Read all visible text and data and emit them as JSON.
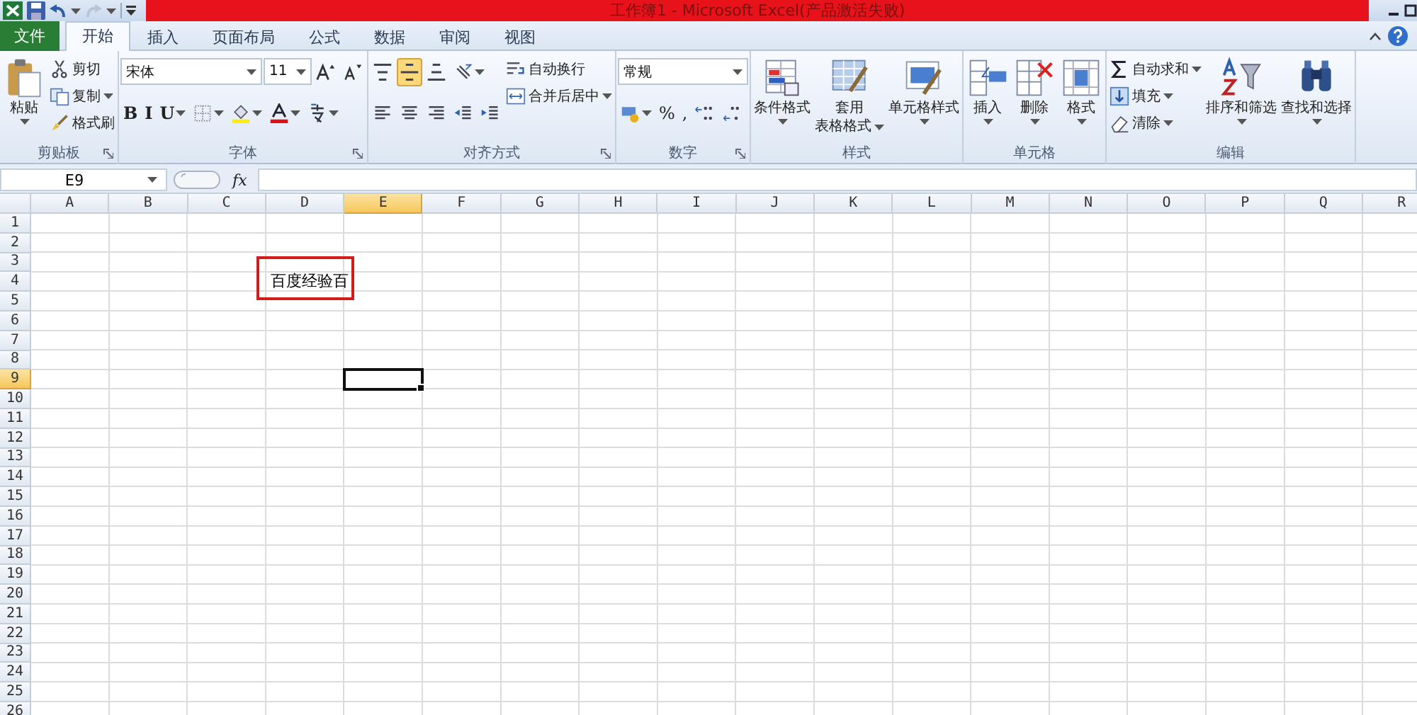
{
  "title_bar": {
    "title": "工作簿1 - Microsoft Excel(产品激活失败)",
    "redo_disabled": true
  },
  "tabs": [
    {
      "label": "文件",
      "kind": "file",
      "selected": false
    },
    {
      "label": "开始",
      "kind": "tab",
      "selected": true
    },
    {
      "label": "插入",
      "kind": "tab",
      "selected": false
    },
    {
      "label": "页面布局",
      "kind": "tab",
      "selected": false
    },
    {
      "label": "公式",
      "kind": "tab",
      "selected": false
    },
    {
      "label": "数据",
      "kind": "tab",
      "selected": false
    },
    {
      "label": "审阅",
      "kind": "tab",
      "selected": false
    },
    {
      "label": "视图",
      "kind": "tab",
      "selected": false
    }
  ],
  "ribbon": {
    "groups": [
      {
        "label": "剪贴板",
        "launcher": true,
        "columns": [
          {
            "kind": "large",
            "label": "粘贴",
            "dropdown": true
          },
          {
            "kind": "stack",
            "items": [
              {
                "kind": "small",
                "label": "剪切",
                "dropdown": false
              },
              {
                "kind": "small",
                "label": "复制",
                "dropdown": true
              },
              {
                "kind": "small",
                "label": "格式刷",
                "dropdown": false
              }
            ]
          }
        ]
      },
      {
        "label": "字体",
        "launcher": true,
        "columns": [
          {
            "kind": "toolbars",
            "toolbars": [
              {
                "items": [
                  {
                    "kind": "combo",
                    "value": "宋体"
                  },
                  {
                    "kind": "combo",
                    "value": "11"
                  },
                  {
                    "kind": "icon",
                    "dropdown": false
                  },
                  {
                    "kind": "icon",
                    "dropdown": false
                  }
                ]
              },
              {
                "items": [
                  {
                    "kind": "text",
                    "label": "B",
                    "selected": false,
                    "dropdown": false
                  },
                  {
                    "kind": "text",
                    "label": "I",
                    "selected": false,
                    "dropdown": false
                  },
                  {
                    "kind": "text",
                    "label": "U",
                    "selected": false,
                    "dropdown": true
                  },
                  {
                    "kind": "icon",
                    "dropdown": true
                  },
                  {
                    "kind": "icon",
                    "dropdown": true
                  },
                  {
                    "kind": "icon",
                    "dropdown": true
                  },
                  {
                    "kind": "icon",
                    "dropdown": true
                  }
                ]
              }
            ]
          }
        ]
      },
      {
        "label": "对齐方式",
        "launcher": true,
        "columns": [
          {
            "kind": "toolbars",
            "toolbars": [
              {
                "items": [
                  {
                    "kind": "icon",
                    "selected": false,
                    "dropdown": false
                  },
                  {
                    "kind": "icon",
                    "selected": true,
                    "dropdown": false
                  },
                  {
                    "kind": "icon",
                    "selected": false,
                    "dropdown": false
                  },
                  {
                    "kind": "icon",
                    "dropdown": true
                  }
                ]
              },
              {
                "items": [
                  {
                    "kind": "icon",
                    "selected": false,
                    "dropdown": false
                  },
                  {
                    "kind": "icon",
                    "selected": false,
                    "dropdown": false
                  },
                  {
                    "kind": "icon",
                    "selected": false,
                    "dropdown": false
                  },
                  {
                    "kind": "icon",
                    "dropdown": false
                  },
                  {
                    "kind": "icon",
                    "dropdown": false
                  }
                ]
              }
            ]
          },
          {
            "kind": "stack",
            "items": [
              {
                "kind": "small",
                "label": "自动换行",
                "dropdown": false
              },
              {
                "kind": "small",
                "label": "合并后居中",
                "dropdown": true
              }
            ]
          }
        ]
      },
      {
        "label": "数字",
        "launcher": true,
        "columns": [
          {
            "kind": "toolbars",
            "toolbars": [
              {
                "items": [
                  {
                    "kind": "combo",
                    "value": "常规"
                  }
                ]
              },
              {
                "items": [
                  {
                    "kind": "icon",
                    "dropdown": true
                  },
                  {
                    "kind": "text",
                    "label": "%",
                    "dropdown": false
                  },
                  {
                    "kind": "text",
                    "label": ",",
                    "dropdown": false
                  },
                  {
                    "kind": "icon",
                    "dropdown": false
                  },
                  {
                    "kind": "icon",
                    "dropdown": false
                  }
                ]
              }
            ]
          }
        ]
      },
      {
        "label": "样式",
        "launcher": false,
        "columns": [
          {
            "kind": "large",
            "label": "条件格式",
            "dropdown": true
          },
          {
            "kind": "large",
            "lines": [
              "套用",
              "表格格式"
            ],
            "dropdown": true
          },
          {
            "kind": "large",
            "label": "单元格样式",
            "dropdown": true
          }
        ]
      },
      {
        "label": "单元格",
        "launcher": false,
        "columns": [
          {
            "kind": "large",
            "label": "插入",
            "dropdown": true
          },
          {
            "kind": "large",
            "label": "删除",
            "dropdown": true
          },
          {
            "kind": "large",
            "label": "格式",
            "dropdown": true
          }
        ]
      },
      {
        "label": "编辑",
        "launcher": false,
        "columns": [
          {
            "kind": "stack",
            "items": [
              {
                "kind": "small",
                "label": "自动求和",
                "dropdown": true
              },
              {
                "kind": "small",
                "label": "填充",
                "dropdown": true
              },
              {
                "kind": "small",
                "label": "清除",
                "dropdown": true
              }
            ]
          },
          {
            "kind": "large",
            "label": "排序和筛选",
            "dropdown": true
          },
          {
            "kind": "large",
            "label": "查找和选择",
            "dropdown": true
          }
        ]
      }
    ]
  },
  "formula_bar": {
    "name_box": "E9",
    "function_label": "fx"
  },
  "sheet": {
    "columns": [
      {
        "label": "A",
        "selected": false
      },
      {
        "label": "B",
        "selected": false
      },
      {
        "label": "C",
        "selected": false
      },
      {
        "label": "D",
        "selected": false
      },
      {
        "label": "E",
        "selected": true
      },
      {
        "label": "F",
        "selected": false
      },
      {
        "label": "G",
        "selected": false
      },
      {
        "label": "H",
        "selected": false
      },
      {
        "label": "I",
        "selected": false
      },
      {
        "label": "J",
        "selected": false
      },
      {
        "label": "K",
        "selected": false
      },
      {
        "label": "L",
        "selected": false
      },
      {
        "label": "M",
        "selected": false
      },
      {
        "label": "N",
        "selected": false
      },
      {
        "label": "O",
        "selected": false
      },
      {
        "label": "P",
        "selected": false
      },
      {
        "label": "Q",
        "selected": false
      },
      {
        "label": "R",
        "selected": false
      }
    ],
    "rows": [
      {
        "label": "1",
        "selected": false
      },
      {
        "label": "2",
        "selected": false
      },
      {
        "label": "3",
        "selected": false
      },
      {
        "label": "4",
        "selected": false,
        "cells": [
          {},
          {},
          {},
          {
            "text": "百度经验百",
            "annotated": true
          }
        ]
      },
      {
        "label": "5",
        "selected": false
      },
      {
        "label": "6",
        "selected": false
      },
      {
        "label": "7",
        "selected": false
      },
      {
        "label": "8",
        "selected": false
      },
      {
        "label": "9",
        "selected": true
      },
      {
        "label": "10",
        "selected": false
      },
      {
        "label": "11",
        "selected": false
      },
      {
        "label": "12",
        "selected": false
      },
      {
        "label": "13",
        "selected": false
      },
      {
        "label": "14",
        "selected": false
      },
      {
        "label": "15",
        "selected": false
      },
      {
        "label": "16",
        "selected": false
      },
      {
        "label": "17",
        "selected": false
      },
      {
        "label": "18",
        "selected": false
      },
      {
        "label": "19",
        "selected": false
      },
      {
        "label": "20",
        "selected": false
      },
      {
        "label": "21",
        "selected": false
      },
      {
        "label": "22",
        "selected": false
      },
      {
        "label": "23",
        "selected": false
      },
      {
        "label": "24",
        "selected": false
      },
      {
        "label": "25",
        "selected": false
      },
      {
        "label": "26",
        "selected": false
      }
    ]
  }
}
